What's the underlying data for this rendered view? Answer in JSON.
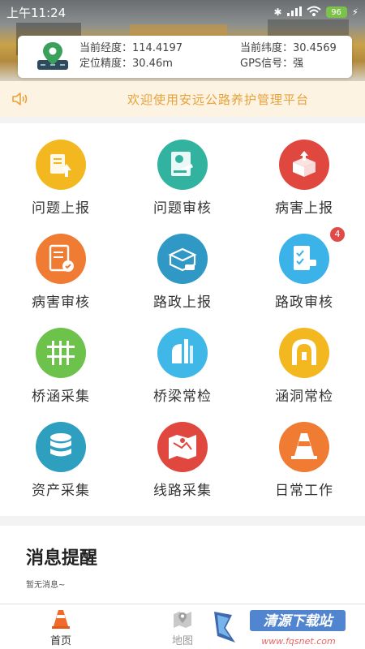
{
  "status_bar": {
    "time": "上午11:24",
    "battery": "96"
  },
  "gps": {
    "longitude": "当前经度：114.4197",
    "latitude": "当前纬度：30.4569",
    "accuracy": "定位精度：30.46m",
    "signal": "GPS信号：强"
  },
  "notice": {
    "text": "欢迎使用安远公路养护管理平台"
  },
  "menu": [
    {
      "label": "问题上报",
      "color": "#f3b81f",
      "icon": "report-icon"
    },
    {
      "label": "问题审核",
      "color": "#31b39f",
      "icon": "review-icon"
    },
    {
      "label": "病害上报",
      "color": "#e0473f",
      "icon": "damage-report-icon"
    },
    {
      "label": "病害审核",
      "color": "#f07b33",
      "icon": "damage-review-icon"
    },
    {
      "label": "路政上报",
      "color": "#2f98c4",
      "icon": "road-report-icon"
    },
    {
      "label": "路政审核",
      "color": "#3bb3e8",
      "icon": "road-review-icon"
    },
    {
      "label": "桥涵采集",
      "color": "#6cc24a",
      "icon": "bridge-collect-icon"
    },
    {
      "label": "桥梁常检",
      "color": "#3fb8e8",
      "icon": "bridge-check-icon"
    },
    {
      "label": "涵洞常检",
      "color": "#f3b81f",
      "icon": "culvert-check-icon"
    },
    {
      "label": "资产采集",
      "color": "#2e9fbf",
      "icon": "asset-collect-icon"
    },
    {
      "label": "线路采集",
      "color": "#e0473f",
      "icon": "route-collect-icon"
    },
    {
      "label": "日常工作",
      "color": "#f07b33",
      "icon": "daily-work-icon"
    }
  ],
  "badge_count": "4",
  "messages": {
    "title": "消息提醒",
    "empty": "暂无消息~"
  },
  "tabs": [
    {
      "label": "首页",
      "active": true
    },
    {
      "label": "地图",
      "active": false
    }
  ],
  "watermark": {
    "text": "清源下载站",
    "url": "www.fqsnet.com"
  }
}
